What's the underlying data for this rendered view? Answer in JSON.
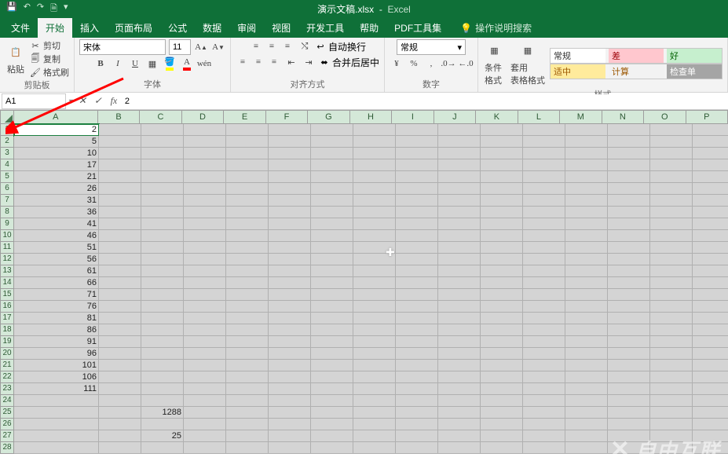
{
  "title": {
    "file": "演示文稿.xlsx",
    "app": "Excel"
  },
  "tabs": [
    "文件",
    "开始",
    "插入",
    "页面布局",
    "公式",
    "数据",
    "审阅",
    "视图",
    "开发工具",
    "帮助",
    "PDF工具集"
  ],
  "active_tab": 1,
  "tell_me": "操作说明搜索",
  "ribbon": {
    "clipboard": {
      "paste": "粘贴",
      "cut": "剪切",
      "copy": "复制",
      "format_painter": "格式刷",
      "label": "剪贴板"
    },
    "font": {
      "name": "宋体",
      "size": "11",
      "label": "字体"
    },
    "alignment": {
      "wrap": "自动换行",
      "merge": "合并后居中",
      "label": "对齐方式"
    },
    "number": {
      "format": "常规",
      "label": "数字"
    },
    "styles": {
      "cond": "条件格式",
      "table": "套用\n表格格式",
      "normal": "常规",
      "bad": "差",
      "good": "好",
      "neutral": "适中",
      "calc": "计算",
      "check": "检查单",
      "label": "样式"
    }
  },
  "namebox": "A1",
  "formula": "2",
  "columns": [
    "A",
    "B",
    "C",
    "D",
    "E",
    "F",
    "G",
    "H",
    "I",
    "J",
    "K",
    "L",
    "M",
    "N",
    "O",
    "P"
  ],
  "wide_col": 0,
  "rows": [
    "1",
    "2",
    "3",
    "4",
    "5",
    "6",
    "7",
    "8",
    "9",
    "10",
    "11",
    "12",
    "13",
    "14",
    "15",
    "16",
    "17",
    "18",
    "19",
    "20",
    "21",
    "22",
    "23",
    "24",
    "25",
    "26",
    "27",
    "28"
  ],
  "data": {
    "A1": "2",
    "A2": "5",
    "A3": "10",
    "A4": "17",
    "A5": "21",
    "A6": "26",
    "A7": "31",
    "A8": "36",
    "A9": "41",
    "A10": "46",
    "A11": "51",
    "A12": "56",
    "A13": "61",
    "A14": "66",
    "A15": "71",
    "A16": "76",
    "A17": "81",
    "A18": "86",
    "A19": "91",
    "A20": "96",
    "A21": "101",
    "A22": "106",
    "A23": "111",
    "C25": "1288",
    "C27": "25"
  },
  "watermark": "自由互联"
}
